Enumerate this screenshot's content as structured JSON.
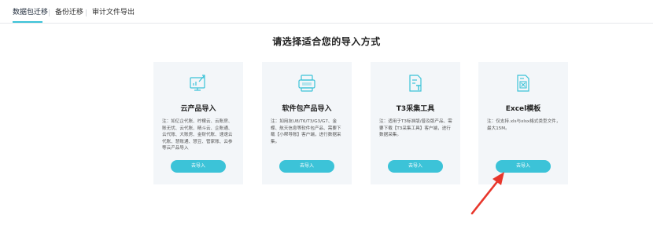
{
  "tabs": [
    {
      "label": "数据包迁移",
      "active": true
    },
    {
      "label": "备份迁移",
      "active": false
    },
    {
      "label": "审计文件导出",
      "active": false
    }
  ],
  "heading": "请选择适合您的导入方式",
  "cards": [
    {
      "icon": "cloud-product-icon",
      "title": "云产品导入",
      "desc": "注：如亿企代账、柠檬云、云账房、账无忧、云代账、精斗云、企账通、云代账、大账房、金财代账、速速云代账、慧账通、慧豆、管家账、云参等云产品导入",
      "button": "去导入"
    },
    {
      "icon": "software-package-icon",
      "title": "软件包产品导入",
      "desc": "注：如用友U8/T6/T3/G3/G7、金蝶、航天信息等软件包产品、需要下载【小帮导账】客户端，进行数据采集。",
      "button": "去导入"
    },
    {
      "icon": "t3-collect-icon",
      "title": "T3采集工具",
      "desc": "注：适用于T3标准版/普及版产品、需要下载【T3采集工具】客户端，进行数据采集。",
      "button": "去导入"
    },
    {
      "icon": "excel-template-icon",
      "title": "Excel模板",
      "desc": "注：仅支持.xls与xlsx格式类型文件，最大15M。",
      "button": "去导入"
    }
  ],
  "colors": {
    "accent": "#3cc3d8",
    "card_bg": "#f3f6f9",
    "arrow": "#e8362b"
  }
}
